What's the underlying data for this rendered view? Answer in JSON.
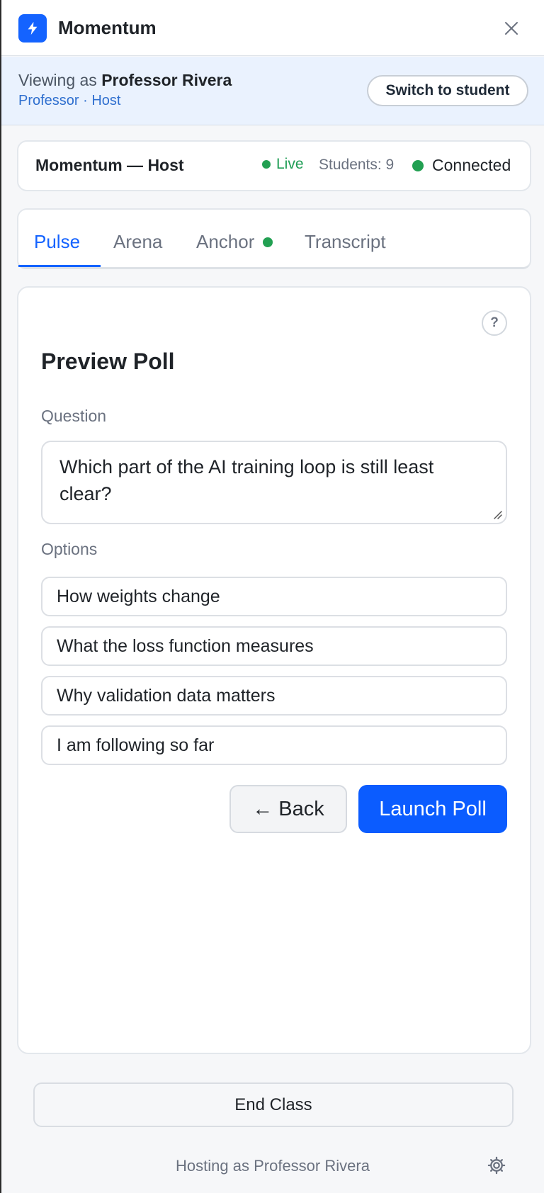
{
  "app": {
    "title": "Momentum",
    "logo_icon": "lightning-icon",
    "close_icon": "close-icon",
    "accent_color": "#1463ff"
  },
  "viewing": {
    "prefix": "Viewing as",
    "name": "Professor Rivera",
    "role": "Professor · Host",
    "switch_label": "Switch to student"
  },
  "status": {
    "title": "Momentum — Host",
    "live_label": "Live",
    "students_label": "Students: 9",
    "connection_label": "Connected",
    "status_color": "#22a052"
  },
  "tabs": [
    {
      "label": "Pulse",
      "active": true
    },
    {
      "label": "Arena",
      "active": false
    },
    {
      "label": "Anchor",
      "active": false,
      "indicator": "green-dot"
    },
    {
      "label": "Transcript",
      "active": false
    }
  ],
  "poll": {
    "help_label": "?",
    "heading": "Preview Poll",
    "question_label": "Question",
    "question_value": "Which part of the AI training loop is still least clear?",
    "options_label": "Options",
    "options": [
      "How weights change",
      "What the loss function measures",
      "Why validation data matters",
      "I am following so far"
    ],
    "back_label": "← Back",
    "launch_label": "Launch Poll"
  },
  "footer": {
    "end_class_label": "End Class",
    "hosting_text": "Hosting as Professor Rivera",
    "settings_icon": "gear-icon"
  }
}
